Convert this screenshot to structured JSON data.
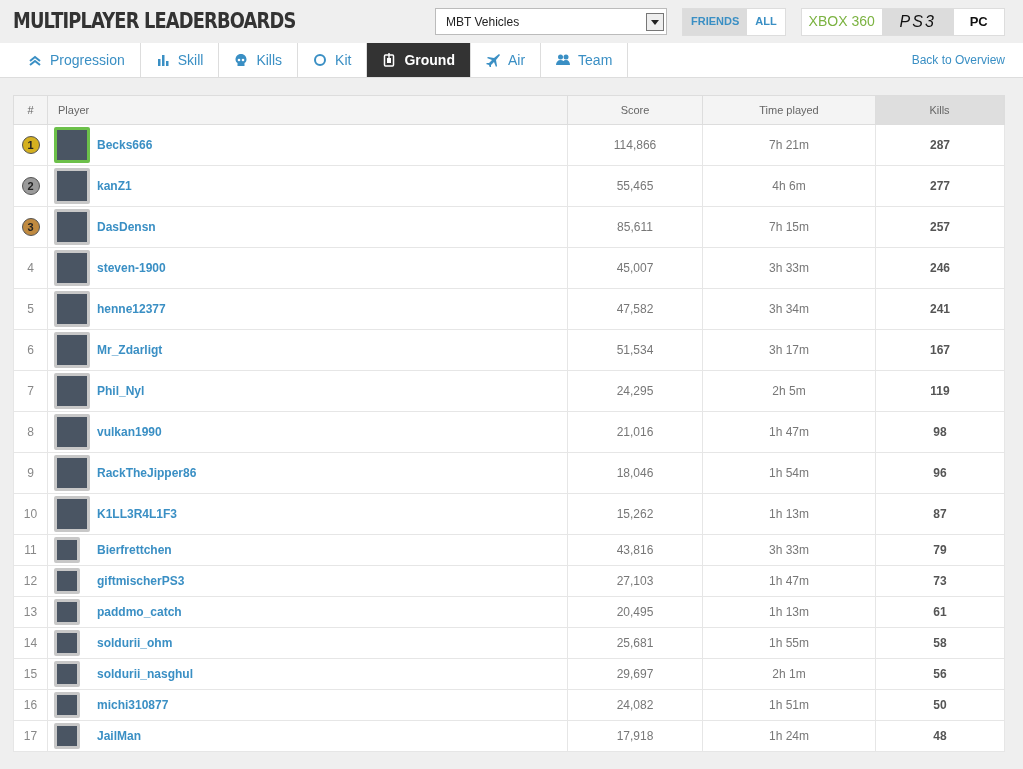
{
  "title": "MULTIPLAYER LEADERBOARDS",
  "category_select": {
    "value": "MBT Vehicles"
  },
  "scope_toggle": [
    {
      "label": "FRIENDS",
      "selected": true
    },
    {
      "label": "ALL",
      "selected": false
    }
  ],
  "platform_toggle": [
    {
      "label": "XBOX 360",
      "kind": "xbox",
      "selected": false
    },
    {
      "label": "PS3",
      "kind": "ps3",
      "selected": true
    },
    {
      "label": "PC",
      "kind": "pc",
      "selected": false
    }
  ],
  "tabs": [
    {
      "label": "Progression",
      "kind": "chevrons",
      "selected": false
    },
    {
      "label": "Skill",
      "kind": "bars",
      "selected": false
    },
    {
      "label": "Kills",
      "kind": "skull",
      "selected": false
    },
    {
      "label": "Kit",
      "kind": "ring",
      "selected": false
    },
    {
      "label": "Ground",
      "kind": "tank",
      "selected": true
    },
    {
      "label": "Air",
      "kind": "jet",
      "selected": false
    },
    {
      "label": "Team",
      "kind": "people",
      "selected": false
    }
  ],
  "back_link": "Back to Overview",
  "table": {
    "columns": [
      {
        "label": "#",
        "sorted": false
      },
      {
        "label": "Player",
        "sorted": false
      },
      {
        "label": "Score",
        "sorted": false
      },
      {
        "label": "Time played",
        "sorted": false
      },
      {
        "label": "Kills",
        "sorted": true
      }
    ],
    "rows": [
      {
        "rank": {
          "kind": "medal",
          "text": "1",
          "color": "#d4b020"
        },
        "avatar": {
          "kind": "large",
          "selected": true
        },
        "player": "Becks666",
        "score": "114,866",
        "time": "7h 21m",
        "kills": "287"
      },
      {
        "rank": {
          "kind": "medal",
          "text": "2",
          "color": "#9a9a9a"
        },
        "avatar": {
          "kind": "large",
          "selected": false
        },
        "player": "kanZ1",
        "score": "55,465",
        "time": "4h 6m",
        "kills": "277"
      },
      {
        "rank": {
          "kind": "medal",
          "text": "3",
          "color": "#c08a40"
        },
        "avatar": {
          "kind": "large",
          "selected": false
        },
        "player": "DasDensn",
        "score": "85,611",
        "time": "7h 15m",
        "kills": "257"
      },
      {
        "rank": {
          "kind": "plain",
          "text": "4"
        },
        "avatar": {
          "kind": "large",
          "selected": false
        },
        "player": "steven-1900",
        "score": "45,007",
        "time": "3h 33m",
        "kills": "246"
      },
      {
        "rank": {
          "kind": "plain",
          "text": "5"
        },
        "avatar": {
          "kind": "large",
          "selected": false
        },
        "player": "henne12377",
        "score": "47,582",
        "time": "3h 34m",
        "kills": "241"
      },
      {
        "rank": {
          "kind": "plain",
          "text": "6"
        },
        "avatar": {
          "kind": "large",
          "selected": false
        },
        "player": "Mr_Zdarligt",
        "score": "51,534",
        "time": "3h 17m",
        "kills": "167"
      },
      {
        "rank": {
          "kind": "plain",
          "text": "7"
        },
        "avatar": {
          "kind": "large",
          "selected": false
        },
        "player": "Phil_Nyl",
        "score": "24,295",
        "time": "2h 5m",
        "kills": "119"
      },
      {
        "rank": {
          "kind": "plain",
          "text": "8"
        },
        "avatar": {
          "kind": "large",
          "selected": false
        },
        "player": "vulkan1990",
        "score": "21,016",
        "time": "1h 47m",
        "kills": "98"
      },
      {
        "rank": {
          "kind": "plain",
          "text": "9"
        },
        "avatar": {
          "kind": "large",
          "selected": false
        },
        "player": "RackTheJipper86",
        "score": "18,046",
        "time": "1h 54m",
        "kills": "96"
      },
      {
        "rank": {
          "kind": "plain",
          "text": "10"
        },
        "avatar": {
          "kind": "large",
          "selected": false
        },
        "player": "K1LL3R4L1F3",
        "score": "15,262",
        "time": "1h 13m",
        "kills": "87"
      },
      {
        "rank": {
          "kind": "plain",
          "text": "11"
        },
        "avatar": {
          "kind": "small",
          "selected": false
        },
        "player": "Bierfrettchen",
        "score": "43,816",
        "time": "3h 33m",
        "kills": "79"
      },
      {
        "rank": {
          "kind": "plain",
          "text": "12"
        },
        "avatar": {
          "kind": "small",
          "selected": false
        },
        "player": "giftmischerPS3",
        "score": "27,103",
        "time": "1h 47m",
        "kills": "73"
      },
      {
        "rank": {
          "kind": "plain",
          "text": "13"
        },
        "avatar": {
          "kind": "small",
          "selected": false
        },
        "player": "paddmo_catch",
        "score": "20,495",
        "time": "1h 13m",
        "kills": "61"
      },
      {
        "rank": {
          "kind": "plain",
          "text": "14"
        },
        "avatar": {
          "kind": "small",
          "selected": false
        },
        "player": "soldurii_ohm",
        "score": "25,681",
        "time": "1h 55m",
        "kills": "58"
      },
      {
        "rank": {
          "kind": "plain",
          "text": "15"
        },
        "avatar": {
          "kind": "small",
          "selected": false
        },
        "player": "soldurii_nasghul",
        "score": "29,697",
        "time": "2h 1m",
        "kills": "56"
      },
      {
        "rank": {
          "kind": "plain",
          "text": "16"
        },
        "avatar": {
          "kind": "small",
          "selected": false
        },
        "player": "michi310877",
        "score": "24,082",
        "time": "1h 51m",
        "kills": "50"
      },
      {
        "rank": {
          "kind": "plain",
          "text": "17"
        },
        "avatar": {
          "kind": "small",
          "selected": false
        },
        "player": "JailMan",
        "score": "17,918",
        "time": "1h 24m",
        "kills": "48"
      }
    ]
  }
}
